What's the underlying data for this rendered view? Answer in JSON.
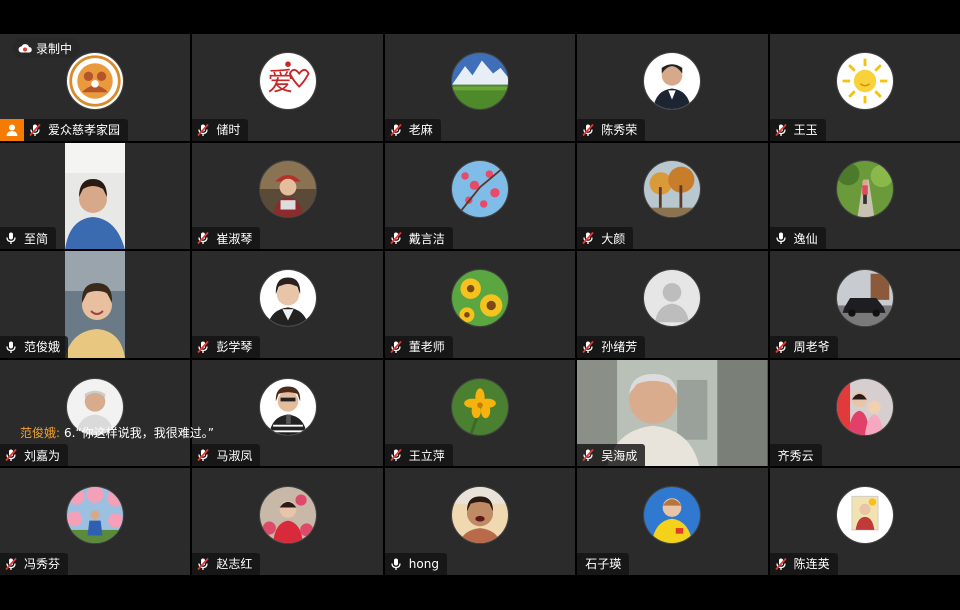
{
  "recording": {
    "label": "录制中"
  },
  "caption": {
    "speaker": "范俊娥:",
    "text": "6.“你这样说我，我很难过。”"
  },
  "colors": {
    "host_badge": "#f57c00",
    "tile_bg": "#2b2b2b",
    "caption_speaker": "#f0a030"
  },
  "participants": [
    {
      "name": "爱众慈孝家园",
      "mic": "muted",
      "avatar": "logo-orange",
      "host": true
    },
    {
      "name": "储时",
      "mic": "muted",
      "avatar": "love-logo"
    },
    {
      "name": "老麻",
      "mic": "muted",
      "avatar": "mountain"
    },
    {
      "name": "陈秀荣",
      "mic": "muted",
      "avatar": "portrait-dark"
    },
    {
      "name": "王玉",
      "mic": "muted",
      "avatar": "sun"
    },
    {
      "name": "至简",
      "mic": "on",
      "avatar": "video-woman-blue"
    },
    {
      "name": "崔淑琴",
      "mic": "muted",
      "avatar": "portrait-hat"
    },
    {
      "name": "戴言洁",
      "mic": "muted",
      "avatar": "blossom-sky"
    },
    {
      "name": "大颜",
      "mic": "muted",
      "avatar": "autumn-tree"
    },
    {
      "name": "逸仙",
      "mic": "on",
      "avatar": "green-path"
    },
    {
      "name": "范俊娥",
      "mic": "on",
      "avatar": "video-woman-smile"
    },
    {
      "name": "彭学琴",
      "mic": "muted",
      "avatar": "portrait-white"
    },
    {
      "name": "董老师",
      "mic": "muted",
      "avatar": "sunflower"
    },
    {
      "name": "孙绪芳",
      "mic": "muted",
      "avatar": "default-person"
    },
    {
      "name": "周老爷",
      "mic": "muted",
      "avatar": "car"
    },
    {
      "name": "刘嘉为",
      "mic": "muted",
      "avatar": "old-man"
    },
    {
      "name": "马淑凤",
      "mic": "muted",
      "avatar": "portrait-mic"
    },
    {
      "name": "王立萍",
      "mic": "muted",
      "avatar": "yellow-flower"
    },
    {
      "name": "吴海成",
      "mic": "muted",
      "avatar": "video-old-man"
    },
    {
      "name": "齐秀云",
      "mic": "none",
      "avatar": "two-people"
    },
    {
      "name": "冯秀芬",
      "mic": "muted",
      "avatar": "blossom-person"
    },
    {
      "name": "赵志红",
      "mic": "muted",
      "avatar": "red-flowers"
    },
    {
      "name": "hong",
      "mic": "on",
      "avatar": "laugh-woman"
    },
    {
      "name": "石子瑛",
      "mic": "none",
      "avatar": "yellow-shirt"
    },
    {
      "name": "陈连英",
      "mic": "muted",
      "avatar": "white-frame"
    }
  ]
}
